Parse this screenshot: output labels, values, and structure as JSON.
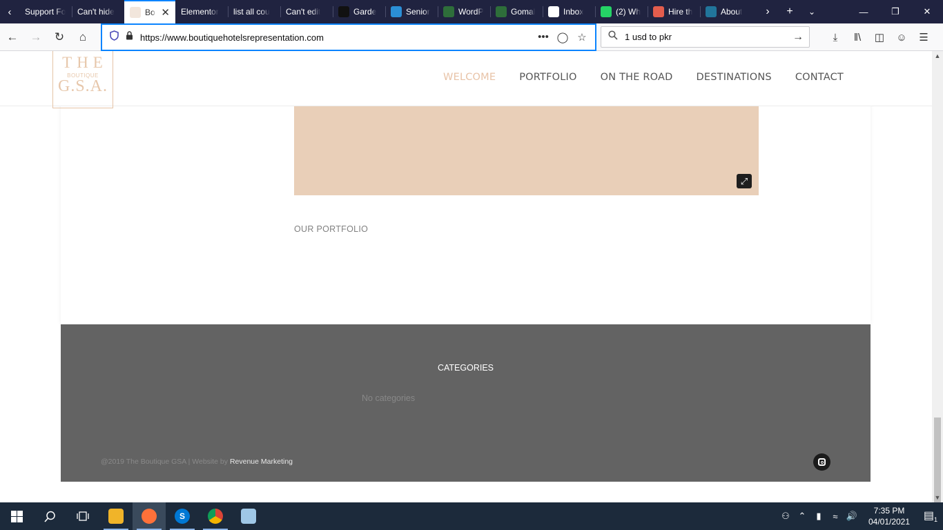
{
  "browser": {
    "tabs": [
      {
        "label": "Support Fo",
        "icon": "support-icon",
        "active": false
      },
      {
        "label": "Can't hide",
        "icon": "generic-page-icon",
        "active": false
      },
      {
        "label": "Bo",
        "icon": "boutique-favicon",
        "active": true
      },
      {
        "label": "Elementor",
        "icon": "generic-page-icon",
        "active": false
      },
      {
        "label": "list all cou",
        "icon": "generic-page-icon",
        "active": false
      },
      {
        "label": "Can't edit",
        "icon": "generic-page-icon",
        "active": false
      },
      {
        "label": "Garde",
        "icon": "garden-icon",
        "active": false
      },
      {
        "label": "Senior",
        "icon": "senior-icon",
        "active": false
      },
      {
        "label": "WordP",
        "icon": "wordpress-green-icon",
        "active": false
      },
      {
        "label": "Gomal",
        "icon": "gomal-icon",
        "active": false
      },
      {
        "label": "Inbox",
        "icon": "gmail-icon",
        "active": false
      },
      {
        "label": "(2) Wh",
        "icon": "whatsapp-icon",
        "active": false
      },
      {
        "label": "Hire th",
        "icon": "hire-icon",
        "active": false
      },
      {
        "label": "About",
        "icon": "wordpress-icon",
        "active": false
      }
    ],
    "url": "https://www.boutiquehotelsrepresentation.com",
    "search_value": "1 usd to pkr"
  },
  "site": {
    "logo": {
      "line1": "THE",
      "line2": "BOUTIQUE",
      "line3": "G.S.A."
    },
    "nav": [
      "WELCOME",
      "PORTFOLIO",
      "ON THE ROAD",
      "DESTINATIONS",
      "CONTACT"
    ],
    "active_nav": "WELCOME",
    "section_title": "OUR PORTFOLIO",
    "footer": {
      "categories_title": "CATEGORIES",
      "categories_empty": "No categories",
      "copyright": "@2019 The Boutique GSA | Website by ",
      "credit_link": "Revenue Marketing"
    }
  },
  "taskbar": {
    "time": "7:35 PM",
    "date": "04/01/2021",
    "notification_count": "1"
  },
  "colors": {
    "accent": "#e8c3a7",
    "media_placeholder": "#e9cfb8",
    "footer_bg": "#636363",
    "tabbar_bg": "#202340"
  }
}
